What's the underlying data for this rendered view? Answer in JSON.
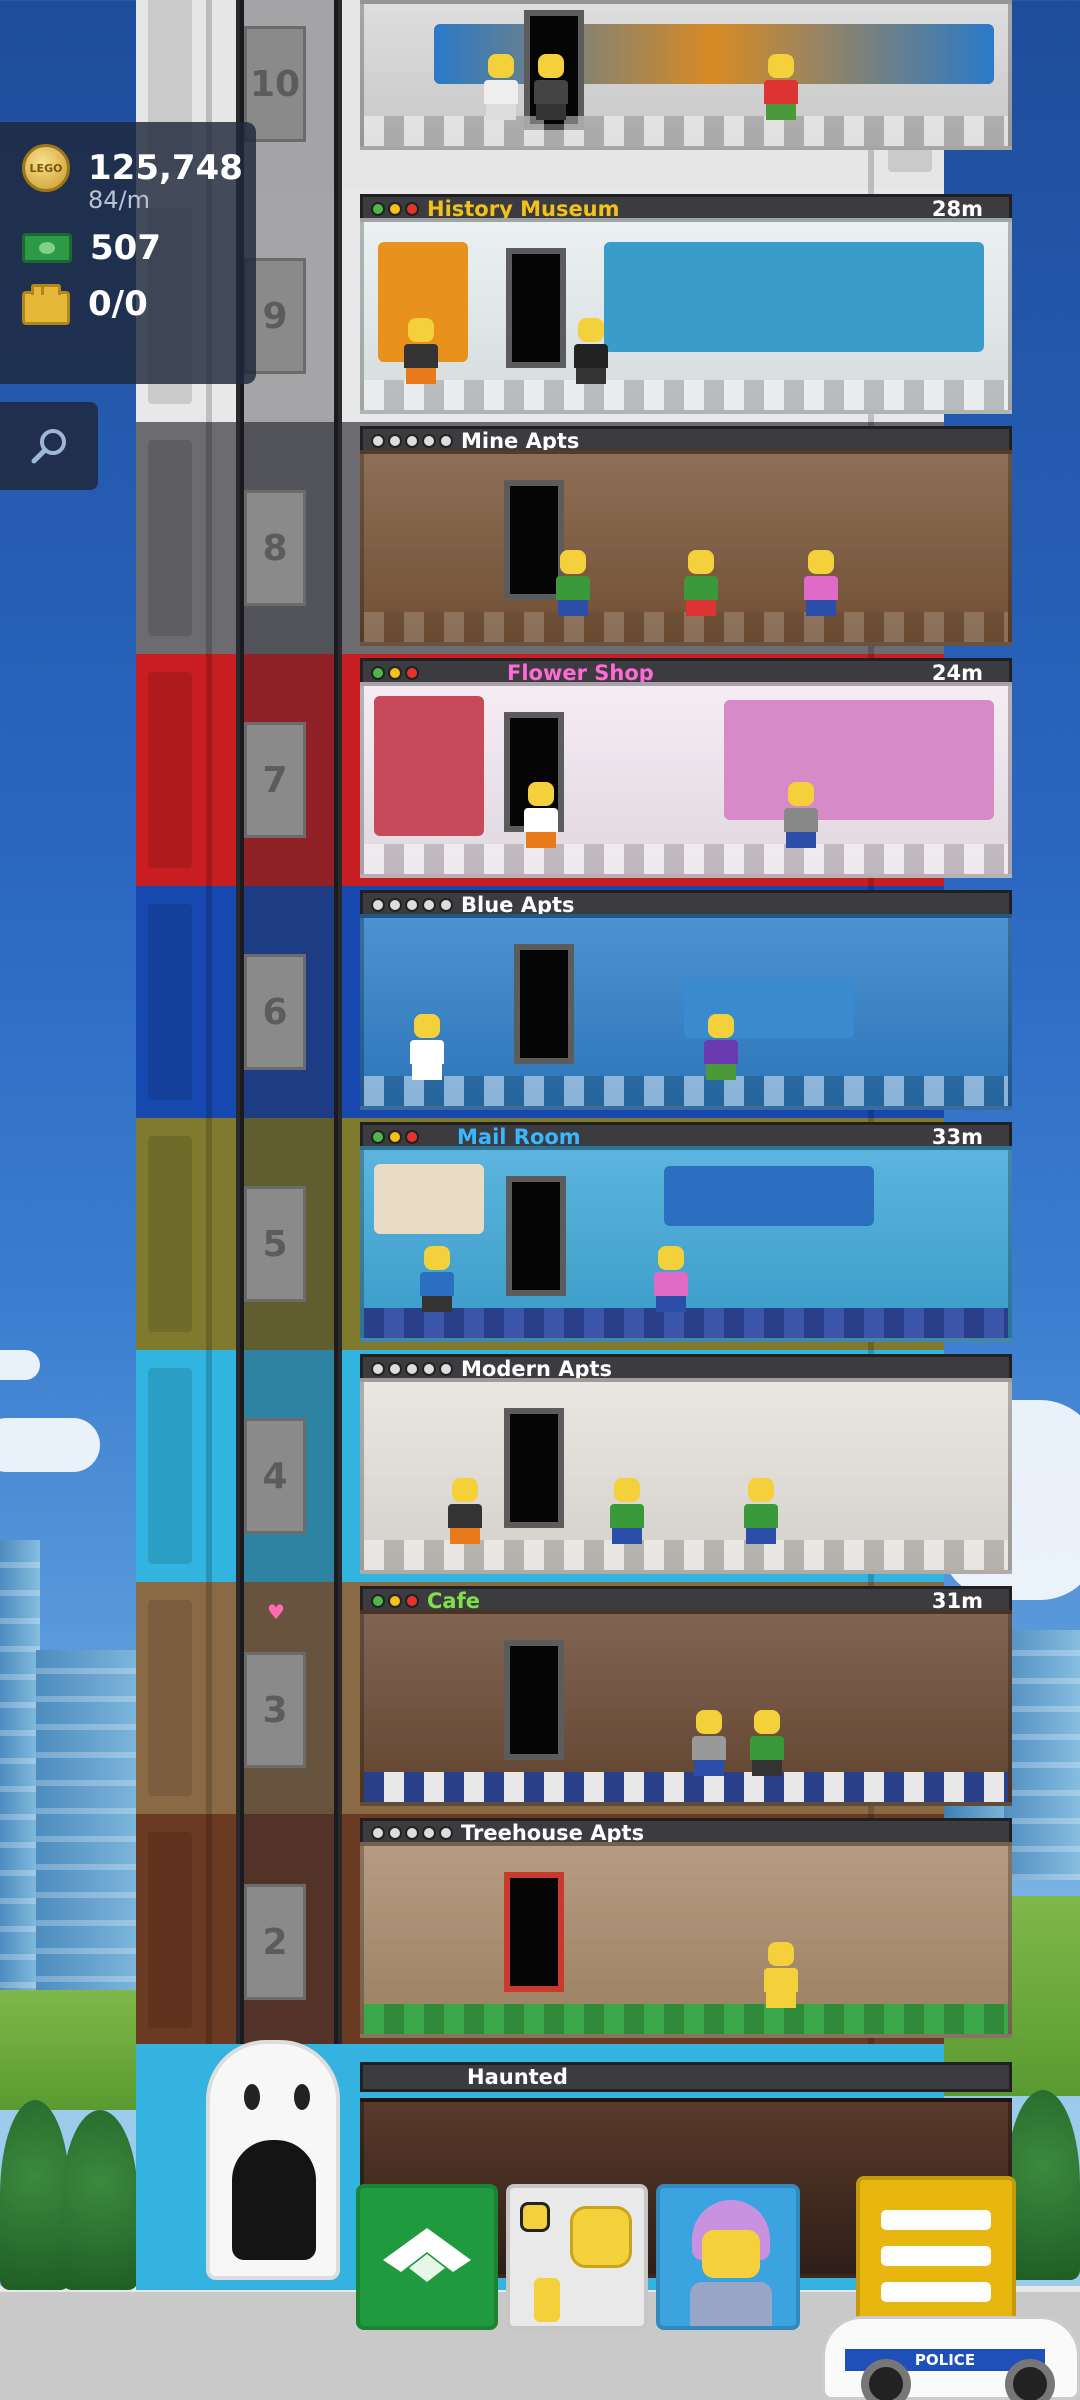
{
  "hud": {
    "coins": "125,748",
    "coin_icon_label": "LEGO",
    "coin_rate": "84/m",
    "bux": "507",
    "bricks": "0/0"
  },
  "floors": [
    {
      "number": "10",
      "name": "",
      "timer": "",
      "type": "airport"
    },
    {
      "number": "9",
      "name": "History Museum",
      "timer": "28m",
      "type": "business",
      "name_color": "#f2c21a"
    },
    {
      "number": "8",
      "name": "Mine Apts",
      "timer": "",
      "type": "residential"
    },
    {
      "number": "7",
      "name": "Flower Shop",
      "timer": "24m",
      "type": "business",
      "name_color": "#ff6ad5"
    },
    {
      "number": "6",
      "name": "Blue Apts",
      "timer": "",
      "type": "residential"
    },
    {
      "number": "5",
      "name": "Mail Room",
      "timer": "33m",
      "type": "business",
      "name_color": "#39b7ff"
    },
    {
      "number": "4",
      "name": "Modern Apts",
      "timer": "",
      "type": "residential"
    },
    {
      "number": "3",
      "name": "Cafe",
      "timer": "31m",
      "type": "business",
      "name_color": "#7ee04a"
    },
    {
      "number": "2",
      "name": "Treehouse Apts",
      "timer": "",
      "type": "residential"
    }
  ],
  "lobby": {
    "name": "Haunted"
  },
  "police_label": "POLICE",
  "colors": {
    "floor10": "#e6e6e6",
    "floor9": "#e8e8e8",
    "floor8": "#6b6b70",
    "floor7": "#c81e22",
    "floor6": "#1748b0",
    "floor5": "#7f7a2e",
    "floor4": "#32b4e0",
    "floor3": "#8a6a45",
    "floor2": "#6b3a22",
    "lobby": "#35b3e0",
    "build_button": "#1f9a3e",
    "menu_button": "#e8b70f"
  },
  "icons": {
    "coin": "coin-icon",
    "bux": "bux-icon",
    "brick": "brick-icon",
    "search": "search-icon",
    "build": "build-plate-icon",
    "menu": "menu-icon",
    "heart": "heart-icon"
  }
}
